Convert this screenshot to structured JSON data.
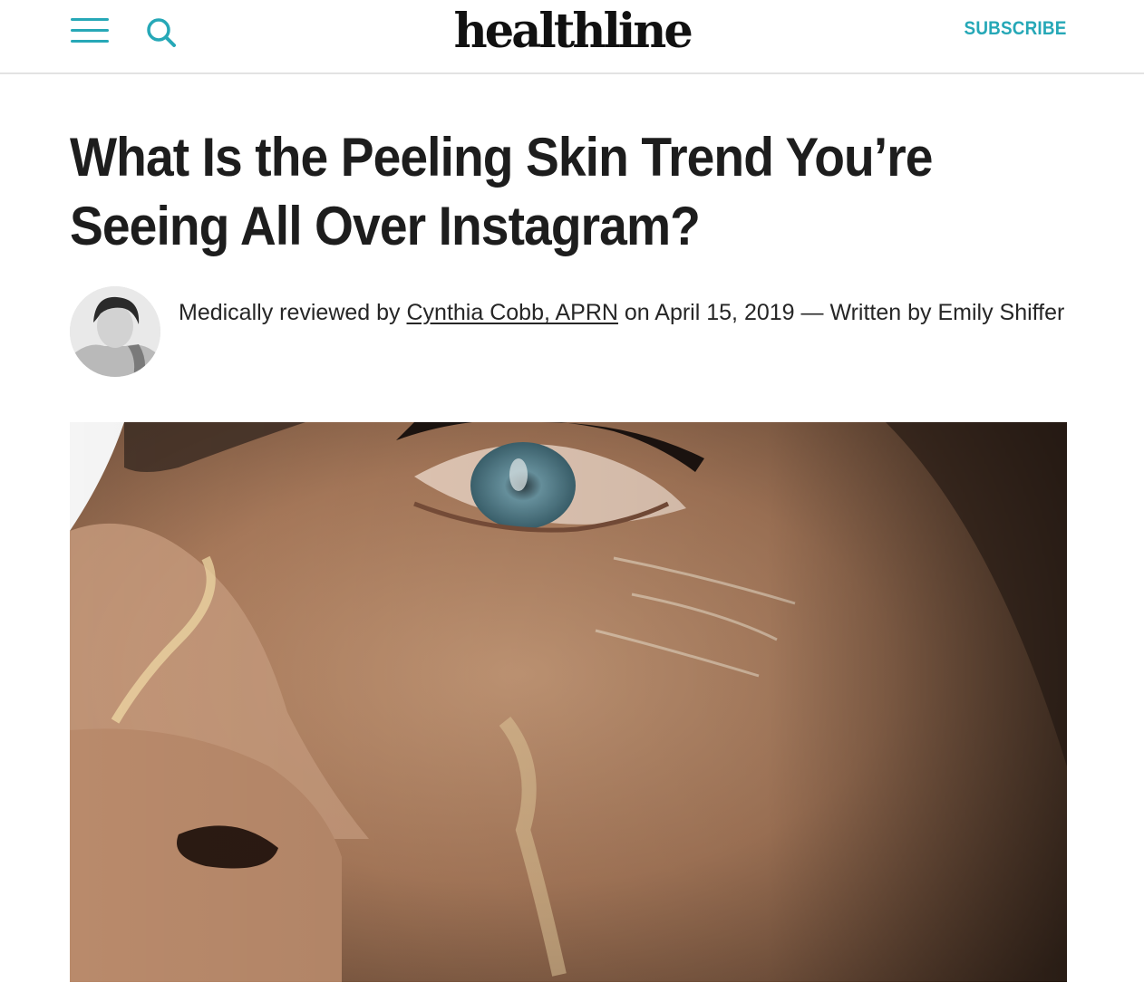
{
  "header": {
    "logo": "healthline",
    "subscribe_label": "SUBSCRIBE",
    "icons": [
      "menu-icon",
      "search-icon"
    ],
    "accent_color": "#26a8b7"
  },
  "article": {
    "title": "What Is the Peeling Skin Trend You’re Seeing All Over Instagram?",
    "byline": {
      "prefix": "Medically reviewed by",
      "reviewer": "Cynthia Cobb, APRN",
      "middle": "on April 15, 2019 — Written by Emily Shiffer"
    }
  }
}
